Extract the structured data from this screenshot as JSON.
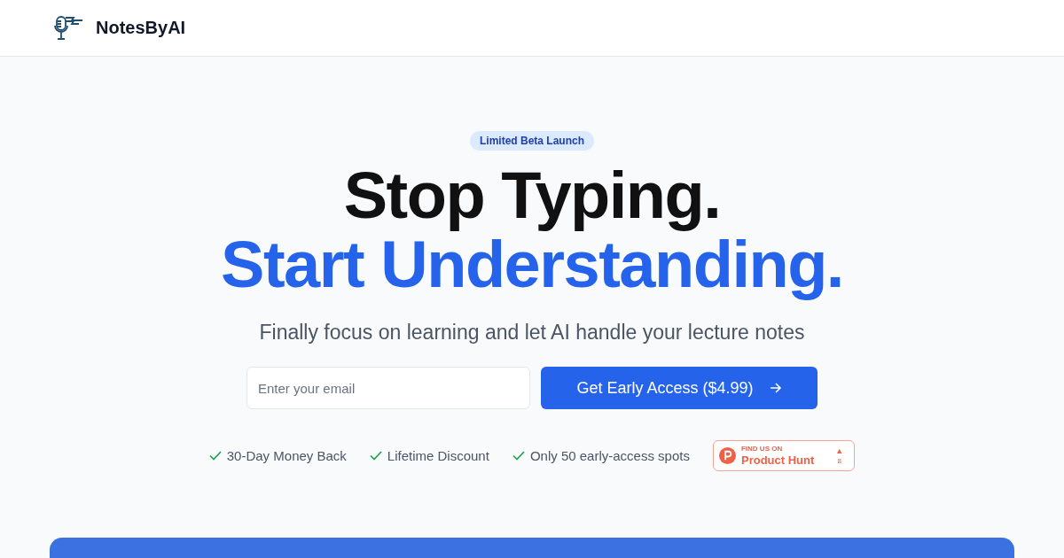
{
  "header": {
    "brand": "NotesByAI"
  },
  "hero": {
    "badge": "Limited Beta Launch",
    "headline_line_1": "Stop Typing.",
    "headline_line_2": "Start Understanding.",
    "subtitle": "Finally focus on learning and let AI handle your lecture notes"
  },
  "signup": {
    "placeholder": "Enter your email",
    "button": "Get Early Access ($4.99)"
  },
  "features": [
    "30-Day Money Back",
    "Lifetime Discount",
    "Only 50 early-access spots"
  ],
  "product_hunt": {
    "caption": "FIND US ON",
    "name": "Product Hunt",
    "upvote": "▲",
    "count": "8"
  }
}
